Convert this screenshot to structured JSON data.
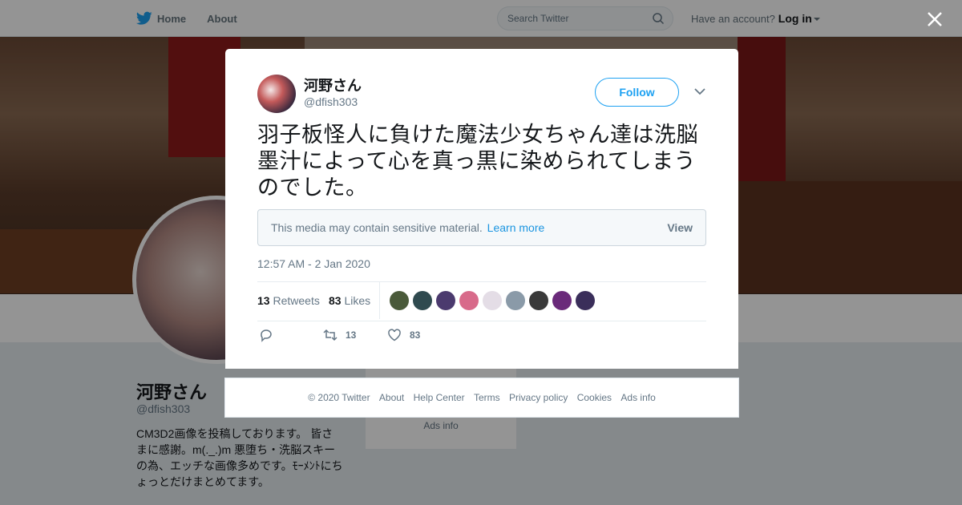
{
  "topbar": {
    "home_label": "Home",
    "about_label": "About",
    "search_placeholder": "Search Twitter",
    "have_account": "Have an account?",
    "login_label": "Log in"
  },
  "profile": {
    "name": "河野さん",
    "handle": "@dfish303",
    "bio": "CM3D2画像を投稿しております。 皆さ\nまに感謝。m(._.)m 悪堕ち・洗脳スキー\nの為、エッチな画像多めです。ﾓｰﾒﾝﾄにち\nょっとだけまとめてます。",
    "card_text": "Ads info"
  },
  "tweet": {
    "author_name": "河野さん",
    "author_handle": "@dfish303",
    "follow_label": "Follow",
    "text": "羽子板怪人に負けた魔法少女ちゃん達は洗脳墨汁によって心を真っ黒に染められてしまうのでした。",
    "sensitive_notice": "This media may contain sensitive material.",
    "learn_more": "Learn more",
    "view_label": "View",
    "timestamp": "12:57 AM - 2 Jan 2020",
    "retweets_count": "13",
    "retweets_label": "Retweets",
    "likes_count": "83",
    "likes_label": "Likes",
    "action_retweet_count": "13",
    "action_like_count": "83"
  },
  "likers": [
    {
      "color": "#4a5a3a"
    },
    {
      "color": "#2f4a4f"
    },
    {
      "color": "#4b3a6e"
    },
    {
      "color": "#d86a8a"
    },
    {
      "color": "#e4dde6"
    },
    {
      "color": "#8a9aa8"
    },
    {
      "color": "#3a3a3a"
    },
    {
      "color": "#6a2a7a"
    },
    {
      "color": "#3a2e5a"
    }
  ],
  "footer": {
    "copyright": "© 2020 Twitter",
    "links": [
      "About",
      "Help Center",
      "Terms",
      "Privacy policy",
      "Cookies",
      "Ads info"
    ]
  },
  "colors": {
    "accent": "#1da1f2",
    "link": "#1b95e0",
    "muted": "#657786"
  }
}
